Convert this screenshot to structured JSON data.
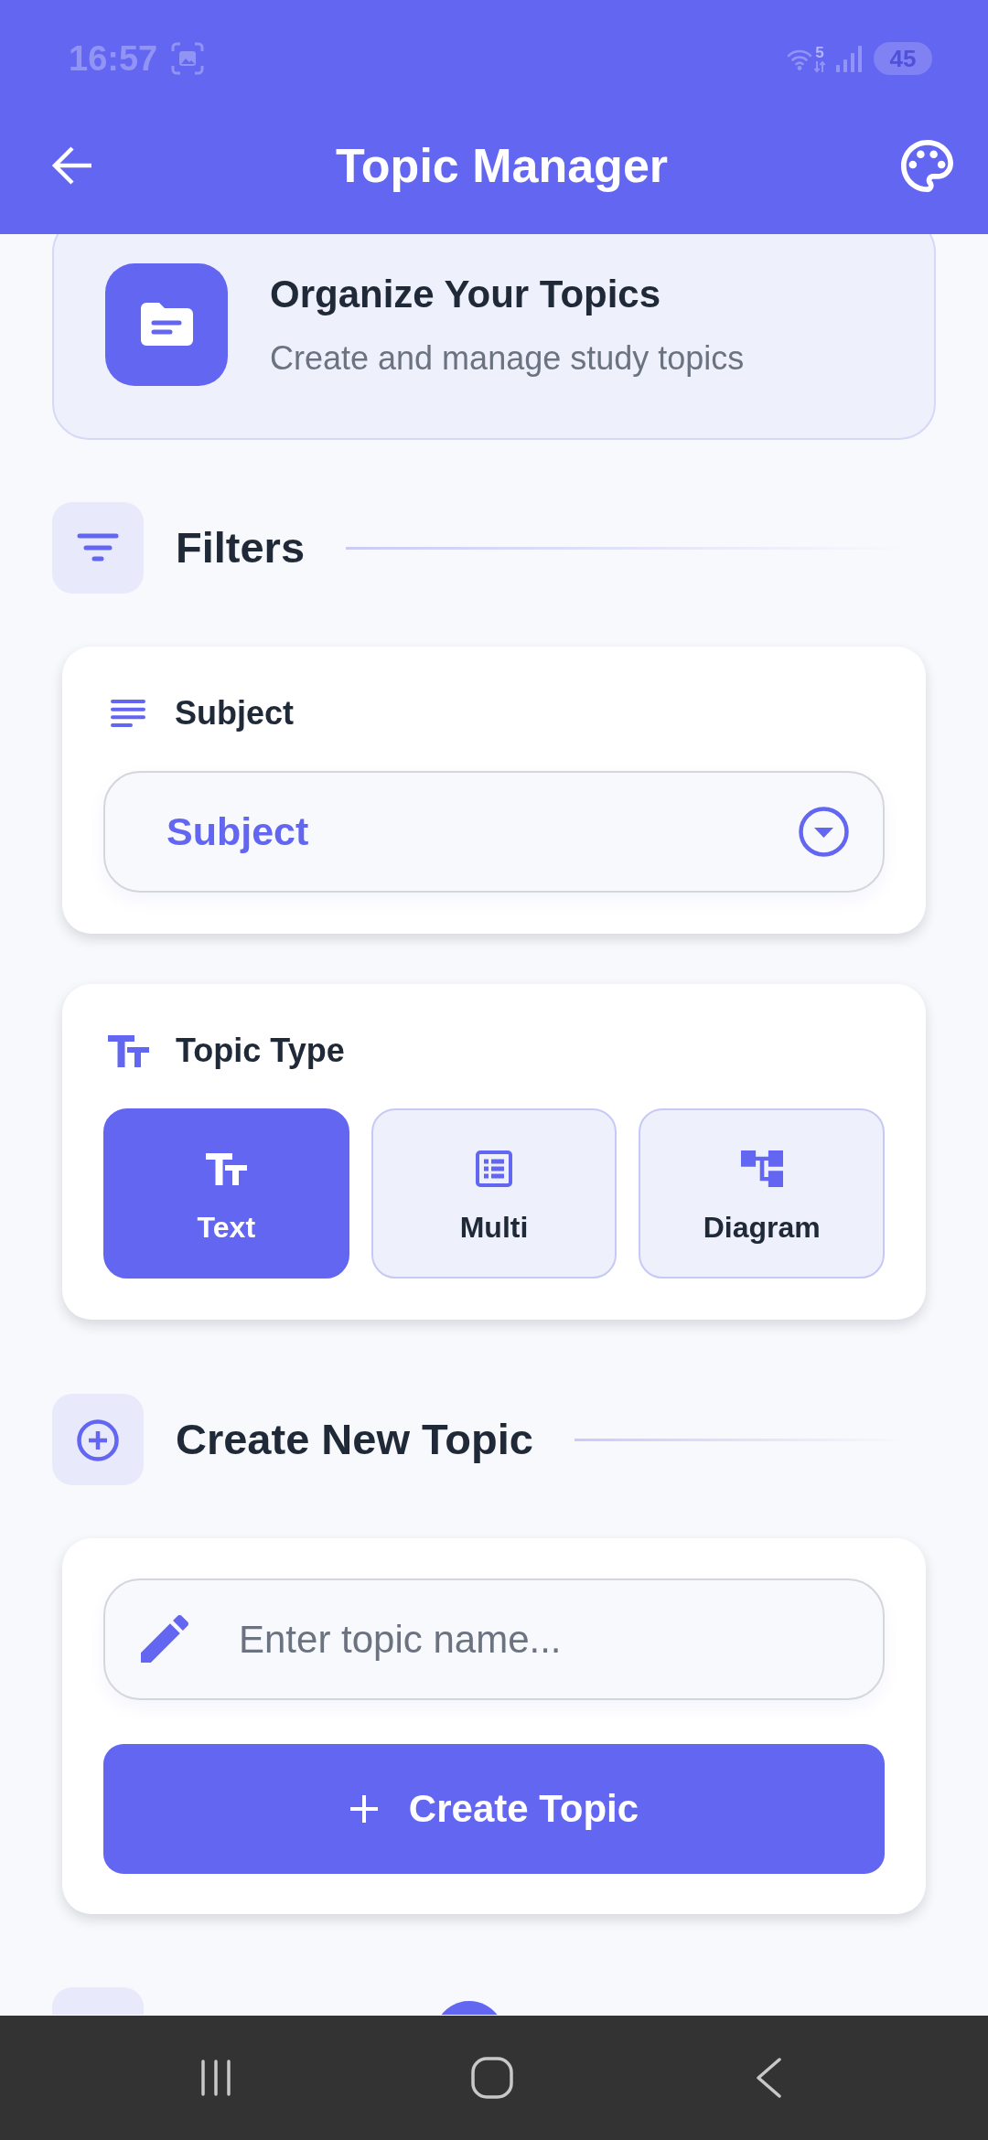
{
  "status_bar": {
    "time": "16:57",
    "wifi_label": "5",
    "battery": "45"
  },
  "header": {
    "title": "Topic Manager"
  },
  "intro_card": {
    "title": "Organize Your Topics",
    "subtitle": "Create and manage study topics"
  },
  "filters": {
    "heading": "Filters",
    "subject": {
      "label": "Subject",
      "dropdown": {
        "value": "Subject"
      }
    },
    "topic_type": {
      "label": "Topic Type",
      "options": [
        {
          "label": "Text",
          "kind": "text",
          "selected": true
        },
        {
          "label": "Multi",
          "kind": "list",
          "selected": false
        },
        {
          "label": "Diagram",
          "kind": "diagram",
          "selected": false
        }
      ]
    }
  },
  "create_topic": {
    "heading": "Create New Topic",
    "name_field": {
      "placeholder": "Enter topic name..."
    },
    "button": "Create Topic"
  }
}
